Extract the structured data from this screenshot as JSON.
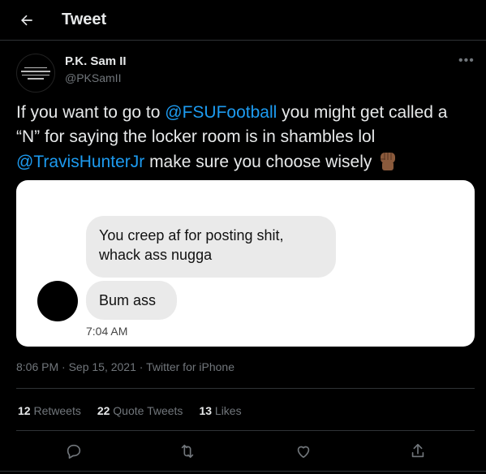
{
  "header": {
    "title": "Tweet",
    "back_icon": "arrow-left-icon"
  },
  "author": {
    "name": "P.K. Sam II",
    "handle": "@PKSamII"
  },
  "more_icon": "ellipsis-icon",
  "tweet": {
    "part1": "If you want to go to ",
    "mention1": "@FSUFootball",
    "part2": " you might get called a “N” for saying the locker room is in shambles lol ",
    "mention2": "@TravisHunterJr",
    "part3": " make sure you choose wisely ",
    "emoji": "raised-fist-medium-dark-skin"
  },
  "media": {
    "bubble1": "You creep af for posting shit, whack ass nugga",
    "bubble2": "Bum ass",
    "time": "7:04 AM"
  },
  "meta": "8:06 PM · Sep 15, 2021 · Twitter for iPhone",
  "stats": {
    "retweets_count": "12",
    "retweets_label": "Retweets",
    "quotes_count": "22",
    "quotes_label": "Quote Tweets",
    "likes_count": "13",
    "likes_label": "Likes"
  },
  "actions": [
    "reply-icon",
    "retweet-icon",
    "like-icon",
    "share-icon"
  ],
  "colors": {
    "accent": "#1d9bf0",
    "muted": "#71767b",
    "background": "#000000",
    "text": "#e7e9ea"
  }
}
